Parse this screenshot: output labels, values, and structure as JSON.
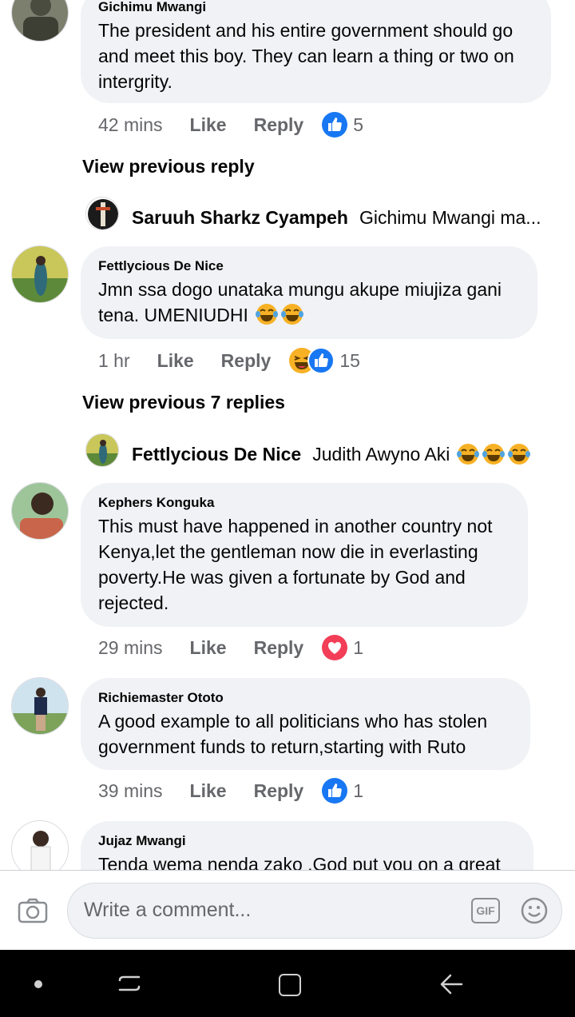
{
  "comments": [
    {
      "name": "Gichimu Mwangi",
      "text": "The president and his entire government should go and meet this boy. They can learn a thing or two on intergrity.",
      "time": "42 mins",
      "like": "Like",
      "reply": "Reply",
      "reaction_count": "5",
      "reactions": [
        "like-icon"
      ]
    },
    {
      "name": "Fettlycious De Nice",
      "text": "Jmn ssa dogo unataka mungu akupe miujiza gani tena.  UMENIUDHI",
      "time": "1 hr",
      "like": "Like",
      "reply": "Reply",
      "reaction_count": "15",
      "reactions": [
        "haha-icon",
        "like-icon"
      ]
    },
    {
      "name": "Kephers Konguka",
      "text": "This must have happened in another country not Kenya,let the gentleman now die in everlasting poverty.He was given a fortunate by God and rejected.",
      "time": "29 mins",
      "like": "Like",
      "reply": "Reply",
      "reaction_count": "1",
      "reactions": [
        "love-icon"
      ]
    },
    {
      "name": "Richiemaster Ototo",
      "text": "A good example to all politicians who has stolen government funds to return,starting with Ruto",
      "time": "39 mins",
      "like": "Like",
      "reply": "Reply",
      "reaction_count": "1",
      "reactions": [
        "like-icon"
      ]
    },
    {
      "name": "Jujaz Mwangi",
      "text": "Tenda wema nenda zako .God put you on a great"
    }
  ],
  "view_previous": [
    "View previous reply",
    "View previous 7 replies"
  ],
  "reply_previews": [
    {
      "name": "Saruuh Sharkz Cyampeh",
      "text": "Gichimu Mwangi ma..."
    },
    {
      "name": "Fettlycious De Nice",
      "text": "Judith Awyno Aki"
    }
  ],
  "composer": {
    "placeholder": "Write a comment...",
    "gif_label": "GIF"
  },
  "colors": {
    "bubble": "#f0f2f5",
    "like_blue": "#1877f2",
    "love_red": "#f33e58",
    "haha_yellow": "#f7b125",
    "meta_grey": "#65676b"
  }
}
